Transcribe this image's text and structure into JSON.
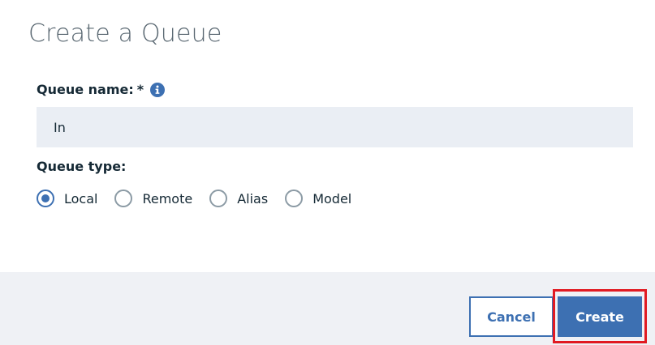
{
  "dialog": {
    "title": "Create a Queue"
  },
  "queue_name": {
    "label": "Queue name:",
    "required_marker": "*",
    "info_icon": "info-icon",
    "value": "In"
  },
  "queue_type": {
    "label": "Queue type:",
    "options": [
      {
        "label": "Local",
        "checked": true
      },
      {
        "label": "Remote",
        "checked": false
      },
      {
        "label": "Alias",
        "checked": false
      },
      {
        "label": "Model",
        "checked": false
      }
    ]
  },
  "footer": {
    "cancel_label": "Cancel",
    "create_label": "Create"
  },
  "colors": {
    "accent": "#3d70b2",
    "highlight": "#e11a22",
    "input_bg": "#eaeef4",
    "footer_bg": "#eff1f5"
  }
}
